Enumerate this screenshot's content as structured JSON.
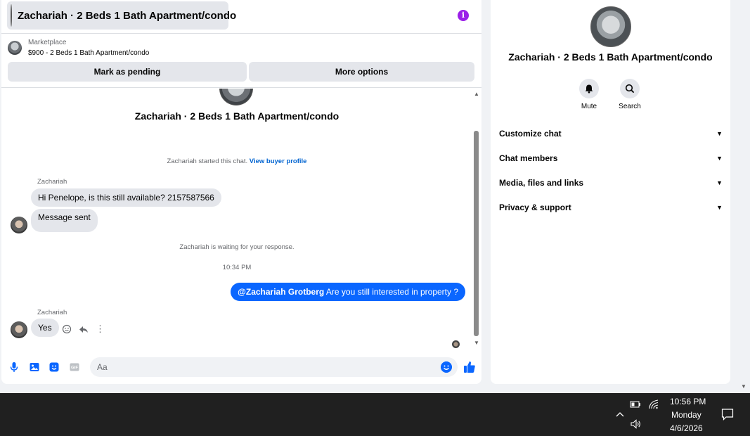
{
  "header": {
    "title": "Zachariah · 2 Beds 1 Bath Apartment/condo",
    "info_icon_glyph": "i"
  },
  "marketplace": {
    "label": "Marketplace",
    "listing": "$900 - 2 Beds 1 Bath Apartment/condo",
    "mark_pending": "Mark as pending",
    "more_options": "More options"
  },
  "thread": {
    "title": "Zachariah · 2 Beds 1 Bath Apartment/condo",
    "started_text": "Zachariah started this chat.",
    "view_profile": "View buyer profile",
    "sender_name": "Zachariah",
    "messages_in": [
      "Hi Penelope, is this still available? 2157587566",
      "Message sent"
    ],
    "waiting_text": "Zachariah is waiting for your response.",
    "timestamp": "10:34 PM",
    "out_mention": "@Zachariah Grotberg",
    "out_text": "Are you still interested in property ?",
    "sender_name_2": "Zachariah",
    "reply": "Yes",
    "more_glyph": "⋮"
  },
  "composer": {
    "placeholder": "Aa",
    "gif_label": "GIF"
  },
  "details": {
    "title": "Zachariah · 2 Beds 1 Bath Apartment/condo",
    "mute": "Mute",
    "search": "Search",
    "sections": [
      "Customize chat",
      "Chat members",
      "Media, files and links",
      "Privacy & support"
    ]
  },
  "taskbar": {
    "time": "10:56 PM",
    "day": "Monday",
    "date": "4/6/2026"
  },
  "colors": {
    "accent": "#0a66ff",
    "info": "#9b1fe8",
    "taskbar": "#202020"
  }
}
